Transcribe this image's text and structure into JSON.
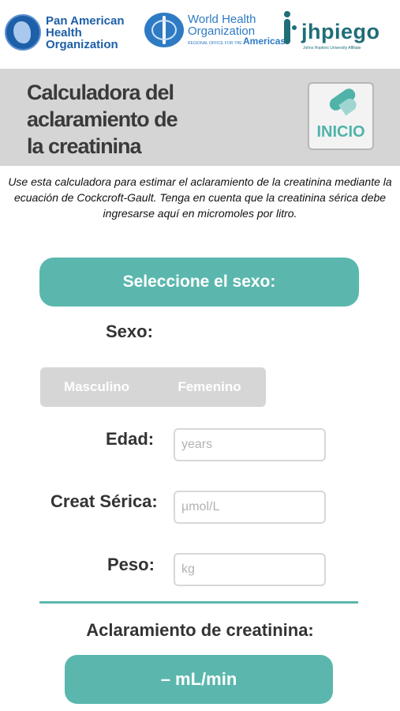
{
  "logos": {
    "paho": {
      "line1": "Pan American",
      "line2": "Health",
      "line3": "Organization"
    },
    "who": {
      "line1": "World Health",
      "line2": "Organization",
      "sub": "REGIONAL OFFICE FOR THE",
      "americas": "Americas"
    },
    "jhpiego": {
      "word": "jhpiego",
      "affiliate": "Johns Hopkins University Affiliate"
    }
  },
  "header": {
    "title_line1": "Calculadora del",
    "title_line2": "aclaramiento de",
    "title_line3": "la creatinina",
    "home_label": "INICIO"
  },
  "description": "Use esta calculadora para estimar el aclaramiento de la creatinina mediante la ecuación de Cockcroft-Gault. Tenga en cuenta que la creatinina sérica debe ingresarse aquí en micromoles por litro.",
  "sex_section": {
    "button_label": "Seleccione el sexo:",
    "sex_label": "Sexo:",
    "options": [
      "Masculino",
      "Femenino"
    ]
  },
  "form": {
    "age": {
      "label": "Edad:",
      "placeholder": "years"
    },
    "creat": {
      "label": "Creat Sérica:",
      "placeholder": "µmol/L"
    },
    "weight": {
      "label": "Peso:",
      "placeholder": "kg"
    }
  },
  "result": {
    "label": "Aclaramiento de creatinina:",
    "value": "– mL/min"
  },
  "colors": {
    "accent": "#5bb7ae",
    "header_bg": "#d5d5d5",
    "brand_blue": "#1d5fa8",
    "jhpiego": "#1f6e78"
  }
}
